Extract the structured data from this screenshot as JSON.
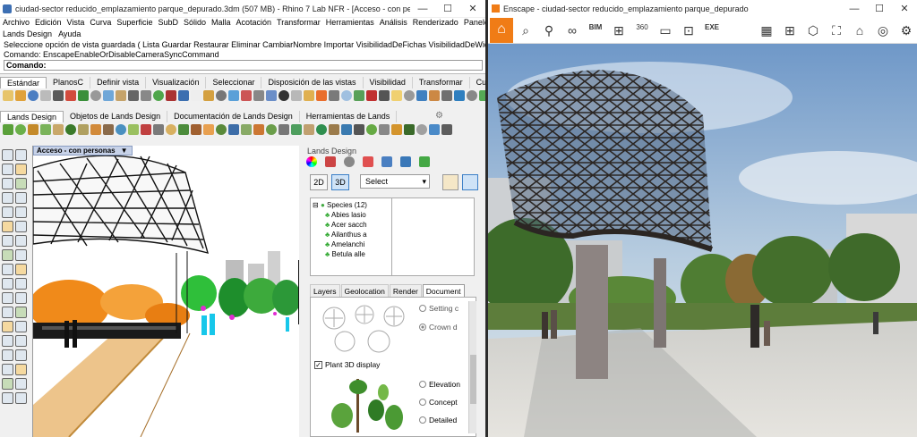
{
  "rhino": {
    "title": "ciudad-sector reducido_emplazamiento parque_depurado.3dm (507 MB) - Rhino 7 Lab NFR - [Acceso - con personas]",
    "menu": [
      "Archivo",
      "Edición",
      "Vista",
      "Curva",
      "Superficie",
      "SubD",
      "Sólido",
      "Malla",
      "Acotación",
      "Transformar",
      "Herramientas",
      "Análisis",
      "Renderizado",
      "Paneles"
    ],
    "menu2": [
      "Lands Design",
      "Ayuda"
    ],
    "cmd_history1": "Seleccione opción de vista guardada ( Lista  Guardar  Restaurar  Eliminar  CambiarNombre  Importar  VisibilidadDeFichas  VisibilidadDeWidgets )",
    "cmd_history2": "Comando: EnscapeEnableOrDisableCameraSyncCommand",
    "cmd_prompt": "Comando:",
    "tabs": [
      "Estándar",
      "PlanosC",
      "Definir vista",
      "Visualización",
      "Seleccionar",
      "Disposición de las vistas",
      "Visibilidad",
      "Transformar",
      "Curvas"
    ],
    "lands_tabs": [
      "Lands Design",
      "Objetos de Lands Design",
      "Documentación de Lands Design",
      "Herramientas de Lands"
    ],
    "viewport_label": "Acceso - con personas",
    "viewport_arrow": "▼"
  },
  "panel": {
    "title": "Lands Design",
    "btn_2d": "2D",
    "btn_3d": "3D",
    "select_label": "Select",
    "tree_root": "Species (12)",
    "species": [
      "Abies lasio",
      "Acer sacch",
      "Ailanthus a",
      "Amelanchi",
      "Betula alle"
    ],
    "tabs": [
      "Layers",
      "Geolocation",
      "Render",
      "Document"
    ],
    "radio_setting": "Setting c",
    "radio_crown": "Crown d",
    "check_plant3d": "Plant 3D display",
    "check_mark": "✓",
    "radio_elevation": "Elevation",
    "radio_concept": "Concept",
    "radio_detailed": "Detailed"
  },
  "enscape": {
    "title": "Enscape - ciudad-sector reducido_emplazamiento parque_depurado",
    "icons_left": [
      "⌕",
      "⚲",
      "∞",
      "BIM",
      "⊞",
      "360",
      "▭",
      "⊡",
      "EXE"
    ],
    "icons_right": [
      "▦",
      "⊞",
      "⬡",
      "⛶",
      "⌂",
      "◎",
      "⚙"
    ],
    "home_icon": "⌂"
  },
  "window_controls": {
    "minimize": "—",
    "maximize": "☐",
    "close": "✕"
  },
  "colors": {
    "enscape_accent": "#f07c16",
    "viewport_tab": "#c7d2e8",
    "selected_btn": "#cfe3f7"
  }
}
